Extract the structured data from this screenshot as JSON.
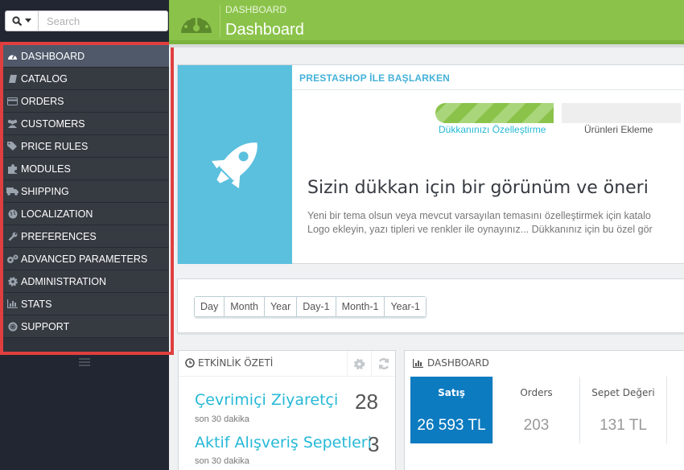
{
  "search": {
    "placeholder": "Search"
  },
  "menu": {
    "items": [
      {
        "label": "DASHBOARD",
        "icon": "dashboard-icon",
        "active": true
      },
      {
        "label": "CATALOG",
        "icon": "book-icon"
      },
      {
        "label": "ORDERS",
        "icon": "credit-card-icon"
      },
      {
        "label": "CUSTOMERS",
        "icon": "users-icon"
      },
      {
        "label": "PRICE RULES",
        "icon": "tags-icon"
      },
      {
        "label": "MODULES",
        "icon": "puzzle-icon"
      },
      {
        "label": "SHIPPING",
        "icon": "truck-icon"
      },
      {
        "label": "LOCALIZATION",
        "icon": "globe-icon"
      },
      {
        "label": "PREFERENCES",
        "icon": "wrench-icon"
      },
      {
        "label": "ADVANCED PARAMETERS",
        "icon": "cogs-icon"
      },
      {
        "label": "ADMINISTRATION",
        "icon": "gear-icon"
      },
      {
        "label": "STATS",
        "icon": "bar-chart-icon"
      },
      {
        "label": "SUPPORT",
        "icon": "lifebuoy-icon"
      }
    ]
  },
  "header": {
    "breadcrumb": "DASHBOARD",
    "title": "Dashboard"
  },
  "onboarding": {
    "title": "PRESTASHOP İLE BAŞLARKEN",
    "step1": "Dükkanınızı Özelleştirme",
    "step1_progress": 1.0,
    "step2": "Ürünleri Ekleme",
    "heading": "Sizin dükkan için bir görünüm ve öneri",
    "text1": "Yeni bir tema olsun veya mevcut varsayılan temasını özelleştirmek için katalo",
    "text2": "Logo ekleyin, yazı tipleri ve renkler ile oynayınız... Dükkanınız için bu özel gör"
  },
  "range": {
    "buttons": [
      "Day",
      "Month",
      "Year",
      "Day-1",
      "Month-1",
      "Year-1"
    ]
  },
  "activity": {
    "title": "ETKİNLİK ÖZETİ",
    "visitors_label": "Çevrimiçi Ziyaretçi",
    "visitors_sub": "son 30 dakika",
    "visitors_value": "28",
    "carts_label": "Aktif Alışveriş Sepetleri",
    "carts_sub": "son 30 dakika",
    "carts_value": "3"
  },
  "dashboard": {
    "title": "DASHBOARD",
    "tiles": [
      {
        "label": "Satış",
        "value": "26 593 TL",
        "active": true
      },
      {
        "label": "Orders",
        "value": "203"
      },
      {
        "label": "Sepet Değeri",
        "value": "131 TL"
      }
    ]
  },
  "colors": {
    "header": "#8bc34a",
    "accent": "#25b9d7",
    "sidebar": "#363a41",
    "highlight_frame": "#e03f3f"
  }
}
